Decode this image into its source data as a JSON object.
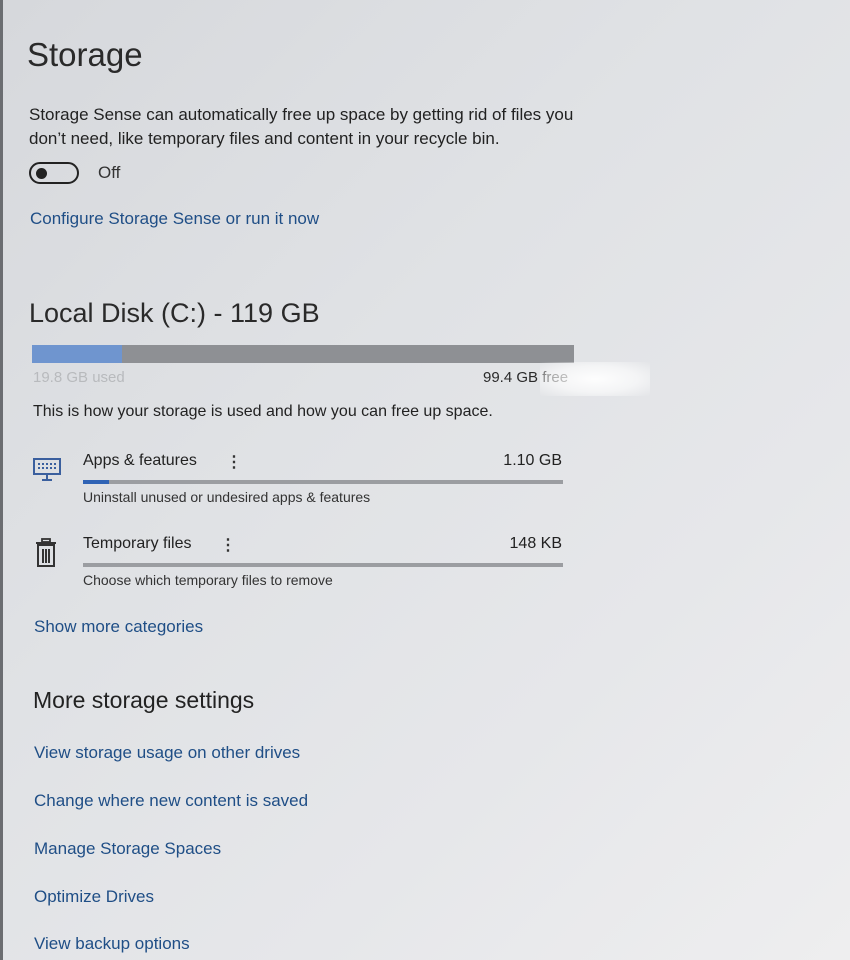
{
  "storage": {
    "title": "Storage",
    "description": "Storage Sense can automatically free up space by getting rid of files you don’t need, like temporary files and content in your recycle bin.",
    "storage_sense_toggle": {
      "state": "Off"
    },
    "configure_link": "Configure Storage Sense or run it now"
  },
  "disk": {
    "title": "Local Disk (C:) - 119 GB",
    "used_label": "19.8 GB used",
    "free_label": "99.4 GB free",
    "used_fraction": 0.166,
    "usage_description": "This is how your storage is used and how you can free up space."
  },
  "categories": [
    {
      "name": "Apps & features",
      "dots": "⋮",
      "size": "1.10 GB",
      "subtitle": "Uninstall unused or undesired apps & features",
      "icon": "keyboard-icon",
      "fraction": 0.055
    },
    {
      "name": "Temporary files",
      "dots": "⋮",
      "size": "148 KB",
      "subtitle": "Choose which temporary files to remove",
      "icon": "trash-icon",
      "fraction": 0.0
    }
  ],
  "show_more_link": "Show more categories",
  "more_settings": {
    "title": "More storage settings",
    "links": [
      "View storage usage on other drives",
      "Change where new content is saved",
      "Manage Storage Spaces",
      "Optimize Drives",
      "View backup options"
    ]
  },
  "colors": {
    "link": "#1f4e86",
    "disk_fill": "#6f95cf",
    "category_fill": "#2f63b5"
  }
}
